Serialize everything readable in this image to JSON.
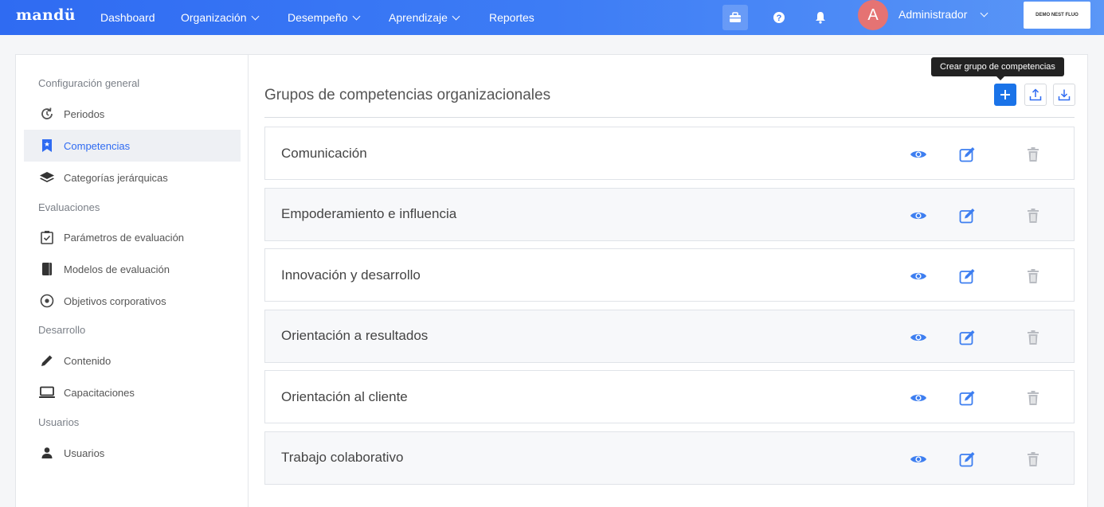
{
  "app": {
    "logo": "mandü",
    "company": "DEMO NEST FLUO",
    "user": "Administrador",
    "user_initial": "A"
  },
  "nav": [
    {
      "label": "Dashboard",
      "has_menu": false
    },
    {
      "label": "Organización",
      "has_menu": true
    },
    {
      "label": "Desempeño",
      "has_menu": true
    },
    {
      "label": "Aprendizaje",
      "has_menu": true
    },
    {
      "label": "Reportes",
      "has_menu": false
    }
  ],
  "nav_icons": [
    "briefcase-icon",
    "help-icon",
    "bell-icon"
  ],
  "sidebar": {
    "sections": [
      {
        "title": "Configuración general",
        "items": [
          {
            "label": "Periodos",
            "icon": "history-icon"
          },
          {
            "label": "Competencias",
            "icon": "bookmark-star-icon",
            "active": true
          },
          {
            "label": "Categorías jerárquicas",
            "icon": "layers-icon"
          }
        ]
      },
      {
        "title": "Evaluaciones",
        "items": [
          {
            "label": "Parámetros de evaluación",
            "icon": "checklist-icon"
          },
          {
            "label": "Modelos de evaluación",
            "icon": "book-icon"
          },
          {
            "label": "Objetivos corporativos",
            "icon": "target-icon"
          }
        ]
      },
      {
        "title": "Desarrollo",
        "items": [
          {
            "label": "Contenido",
            "icon": "pencil-icon"
          },
          {
            "label": "Capacitaciones",
            "icon": "laptop-icon"
          }
        ]
      },
      {
        "title": "Usuarios",
        "items": [
          {
            "label": "Usuarios",
            "icon": "user-icon"
          }
        ]
      }
    ]
  },
  "main": {
    "title": "Grupos de competencias organizacionales",
    "tooltip": "Crear grupo de competencias",
    "groups": [
      "Comunicación",
      "Empoderamiento e influencia",
      "Innovación y desarrollo",
      "Orientación a resultados",
      "Orientación al cliente",
      "Trabajo colaborativo"
    ]
  },
  "colors": {
    "accent": "#2f6bf2",
    "primary_button": "#1a73e8",
    "view_icon": "#3d7ef0",
    "edit_icon": "#3d7ef0",
    "delete_icon": "#b9bcc2"
  }
}
